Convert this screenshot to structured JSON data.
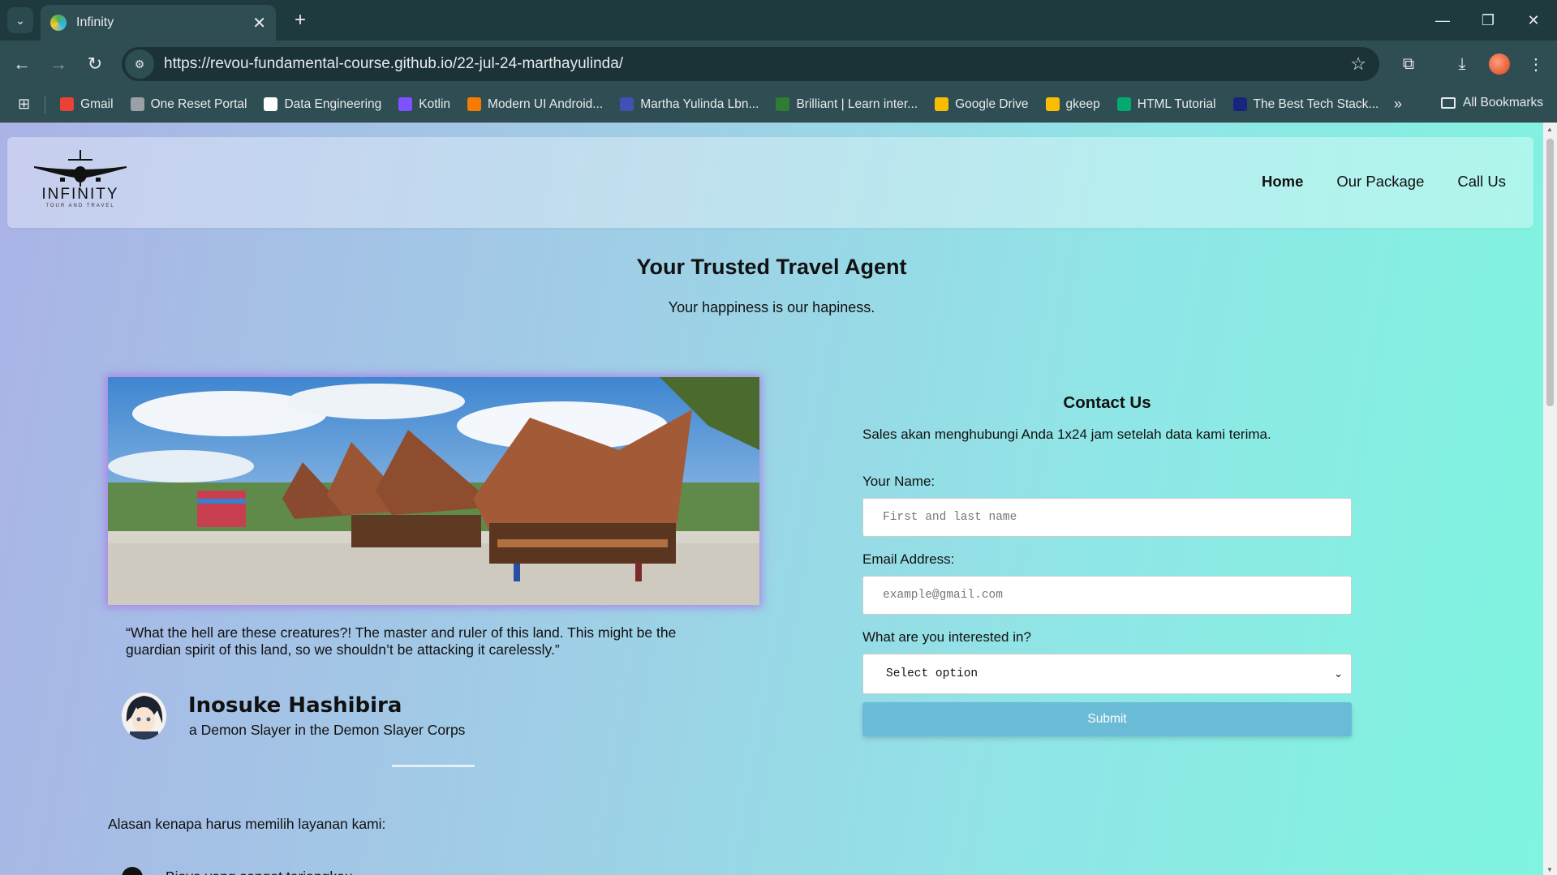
{
  "browser": {
    "tab_title": "Infinity",
    "url": "https://revou-fundamental-course.github.io/22-jul-24-marthayulinda/",
    "bookmarks": [
      {
        "label": "Gmail",
        "color": "#ea4335"
      },
      {
        "label": "One Reset Portal",
        "color": "#9aa0a6"
      },
      {
        "label": "Data Engineering",
        "color": "#ffffff"
      },
      {
        "label": "Kotlin",
        "color": "#7f52ff"
      },
      {
        "label": "Modern UI Android...",
        "color": "#f57c00"
      },
      {
        "label": "Martha Yulinda Lbn...",
        "color": "#3f51b5"
      },
      {
        "label": "Brilliant | Learn inter...",
        "color": "#2e7d32"
      },
      {
        "label": "Google Drive",
        "color": "#fbbc04"
      },
      {
        "label": "gkeep",
        "color": "#fbbc04"
      },
      {
        "label": "HTML Tutorial",
        "color": "#04aa6d"
      },
      {
        "label": "The Best Tech Stack...",
        "color": "#1a237e"
      }
    ],
    "all_bookmarks": "All Bookmarks",
    "more": "»"
  },
  "site": {
    "logo": {
      "brand": "INFINITY",
      "tagline": "TOUR AND TRAVEL"
    },
    "nav": {
      "home": "Home",
      "package": "Our Package",
      "call": "Call Us"
    },
    "hero": {
      "title": "Your Trusted Travel Agent",
      "subtitle": "Your happiness is our hapiness."
    },
    "testimonial": {
      "quote": "“What the hell are these creatures?! The master and ruler of this land. This might be the guardian spirit of this land, so we shouldn’t be attacking it carelessly.”",
      "name": "Inosuke Hashibira",
      "role": "a Demon Slayer in the Demon Slayer Corps"
    },
    "reasons": {
      "heading": "Alasan kenapa harus memilih layanan kami:",
      "first_item_partial": "Biaya yang sangat terjangkau"
    },
    "contact": {
      "title": "Contact Us",
      "description": "Sales akan menghubungi Anda 1x24 jam setelah data kami terima.",
      "name_label": "Your Name:",
      "name_placeholder": "First and last name",
      "email_label": "Email Address:",
      "email_placeholder": "example@gmail.com",
      "interest_label": "What are you interested in?",
      "interest_selected": "Select option",
      "submit": "Submit"
    }
  }
}
